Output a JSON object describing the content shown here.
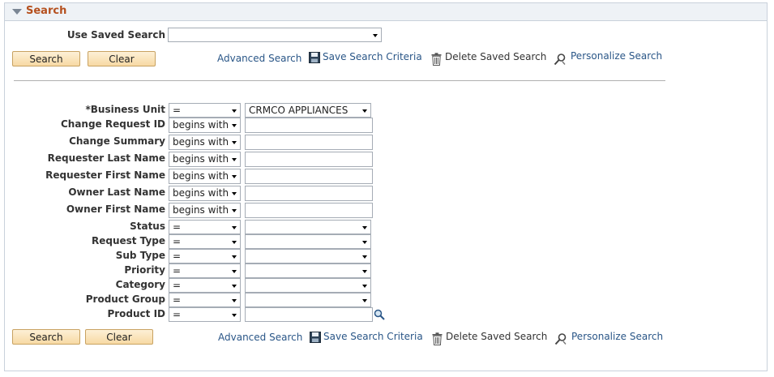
{
  "panel": {
    "title": "Search"
  },
  "saved_search": {
    "label": "Use Saved Search",
    "value": ""
  },
  "buttons": {
    "search": "Search",
    "clear": "Clear"
  },
  "links": {
    "advanced": "Advanced Search",
    "save": "Save Search Criteria",
    "delete": "Delete Saved Search",
    "personalize": "Personalize Search"
  },
  "fields": [
    {
      "label": "*Business Unit",
      "operator": "=",
      "value": "CRMCO APPLIANCES"
    },
    {
      "label": "Change Request ID",
      "operator": "begins with",
      "value": ""
    },
    {
      "label": "Change Summary",
      "operator": "begins with",
      "value": ""
    },
    {
      "label": "Requester Last Name",
      "operator": "begins with",
      "value": ""
    },
    {
      "label": "Requester First Name",
      "operator": "begins with",
      "value": ""
    },
    {
      "label": "Owner Last Name",
      "operator": "begins with",
      "value": ""
    },
    {
      "label": "Owner First Name",
      "operator": "begins with",
      "value": ""
    },
    {
      "label": "Status",
      "operator": "=",
      "value": ""
    },
    {
      "label": "Request Type",
      "operator": "=",
      "value": ""
    },
    {
      "label": "Sub Type",
      "operator": "=",
      "value": ""
    },
    {
      "label": "Priority",
      "operator": "=",
      "value": ""
    },
    {
      "label": "Category",
      "operator": "=",
      "value": ""
    },
    {
      "label": "Product Group",
      "operator": "=",
      "value": ""
    },
    {
      "label": "Product ID",
      "operator": "=",
      "value": ""
    }
  ],
  "icons": {
    "collapse": "triangle-down-icon",
    "save": "floppy-disk-icon",
    "delete": "trash-icon",
    "personalize": "magnifier-wrench-icon",
    "lookup": "lookup-magnifier-icon"
  }
}
